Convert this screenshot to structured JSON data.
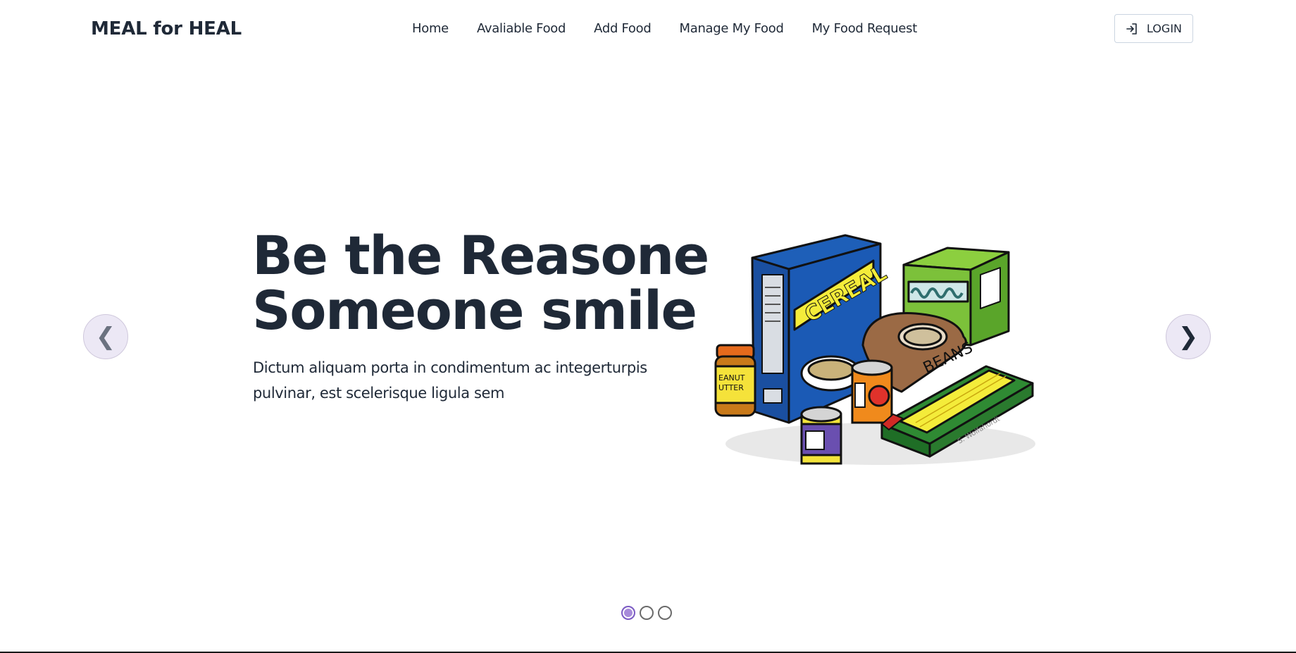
{
  "navbar": {
    "brand": "MEAL for HEAL",
    "links": [
      {
        "label": "Home"
      },
      {
        "label": "Avaliable Food"
      },
      {
        "label": "Add Food"
      },
      {
        "label": "Manage My Food"
      },
      {
        "label": "My Food Request"
      }
    ],
    "login_label": "LOGIN",
    "login_icon": "login-arrow-icon"
  },
  "hero": {
    "title_line1": "Be the Reasone",
    "title_line2": "Someone smile",
    "description": "Dictum aliquam porta in condimentum ac integerturpis pulvinar, est scelerisque ligula sem",
    "illustration": "groceries-illustration",
    "illustration_text": {
      "cereal": "CEREAL",
      "beans": "BEANS",
      "peanut_butter_1": "EANUT",
      "peanut_butter_2": "UTTER",
      "artist_signature": "S. Wolfahordt"
    }
  },
  "carousel": {
    "prev_symbol": "❮",
    "next_symbol": "❯",
    "slide_count": 3,
    "active_slide": 1
  },
  "colors": {
    "text": "#1f2937",
    "accent": "#7c5cc4",
    "arrow_bg": "#ece8f5",
    "background": "#ffffff"
  }
}
